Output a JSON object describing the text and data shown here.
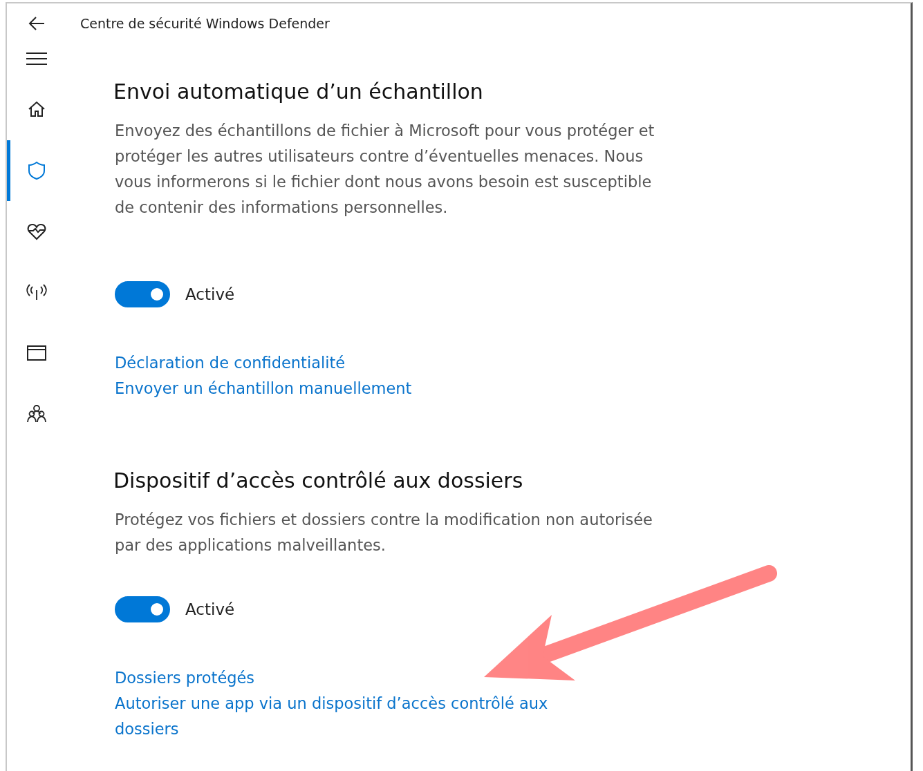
{
  "window": {
    "title": "Centre de sécurité Windows Defender"
  },
  "nav": {
    "items": [
      {
        "kind": "home",
        "selected": false
      },
      {
        "kind": "shield",
        "selected": true
      },
      {
        "kind": "health",
        "selected": false
      },
      {
        "kind": "network",
        "selected": false
      },
      {
        "kind": "browser",
        "selected": false
      },
      {
        "kind": "family",
        "selected": false
      }
    ]
  },
  "sections": [
    {
      "heading": "Envoi automatique d’un échantillon",
      "description": "Envoyez des échantillons de fichier à Microsoft pour vous protéger et protéger les autres utilisateurs contre d’éventuelles menaces. Nous vous informerons si le fichier dont nous avons besoin est susceptible de contenir des informations personnelles.",
      "toggle": {
        "on": true,
        "label": "Activé"
      },
      "links": [
        "Déclaration de confidentialité",
        "Envoyer un échantillon manuellement"
      ]
    },
    {
      "heading": "Dispositif d’accès contrôlé aux dossiers",
      "description": "Protégez vos fichiers et dossiers contre la modification non autorisée par des applications malveillantes.",
      "toggle": {
        "on": true,
        "label": "Activé"
      },
      "links": [
        "Dossiers protégés",
        "Autoriser une app via un dispositif d’accès contrôlé aux dossiers"
      ]
    }
  ]
}
